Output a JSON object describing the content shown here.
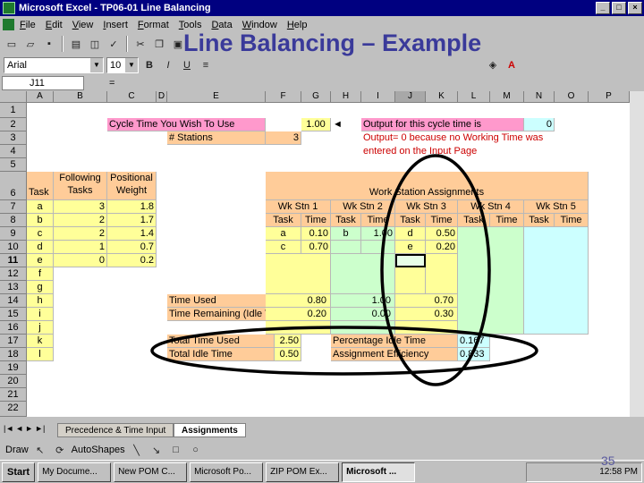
{
  "window": {
    "title": "Microsoft Excel - TP06-01 Line Balancing",
    "controls": [
      "_",
      "□",
      "×"
    ]
  },
  "menu": [
    "File",
    "Edit",
    "View",
    "Insert",
    "Format",
    "Tools",
    "Data",
    "Window",
    "Help"
  ],
  "slide_title": "Line Balancing – Example",
  "format_toolbar": {
    "font": "Arial",
    "size": "10"
  },
  "formula_bar": {
    "name_box": "J11",
    "equals": "="
  },
  "column_headers": [
    "A",
    "B",
    "C",
    "D",
    "E",
    "F",
    "G",
    "H",
    "I",
    "J",
    "K",
    "L",
    "M",
    "N",
    "O",
    "P"
  ],
  "row_numbers": [
    "1",
    "2",
    "3",
    "4",
    "5",
    "6",
    "7",
    "8",
    "9",
    "10",
    "11",
    "12",
    "13",
    "14",
    "15",
    "16",
    "17",
    "18",
    "19",
    "20",
    "21",
    "22"
  ],
  "sheet": {
    "cycle_time_label": "Cycle Time You Wish To Use",
    "cycle_time_value": "1.00",
    "stations_label": "# Stations",
    "stations_value": "3",
    "output_label": "Output for this cycle time is",
    "output_value": "0",
    "output_note_1": "Output= 0 because no Working Time was",
    "output_note_2": "entered on the Input Page",
    "headers": {
      "task": "Task",
      "following_1": "Following",
      "following_2": "Tasks",
      "positional_1": "Positional",
      "positional_2": "Weight",
      "assignments": "Work Station Assignments"
    },
    "stations": [
      "Wk Stn 1",
      "Wk Stn 2",
      "Wk Stn 3",
      "Wk Stn 4",
      "Wk Stn 5"
    ],
    "sub_task": "Task",
    "sub_time": "Time",
    "tasks": [
      {
        "task": "a",
        "following": "3",
        "weight": "1.8"
      },
      {
        "task": "b",
        "following": "2",
        "weight": "1.7"
      },
      {
        "task": "c",
        "following": "2",
        "weight": "1.4"
      },
      {
        "task": "d",
        "following": "1",
        "weight": "0.7"
      },
      {
        "task": "e",
        "following": "0",
        "weight": "0.2"
      },
      {
        "task": "f",
        "following": "",
        "weight": ""
      },
      {
        "task": "g",
        "following": "",
        "weight": ""
      },
      {
        "task": "h",
        "following": "",
        "weight": ""
      },
      {
        "task": "i",
        "following": "",
        "weight": ""
      },
      {
        "task": "j",
        "following": "",
        "weight": ""
      },
      {
        "task": "k",
        "following": "",
        "weight": ""
      },
      {
        "task": "l",
        "following": "",
        "weight": ""
      }
    ],
    "assign_rows": [
      {
        "s1_task": "a",
        "s1_time": "0.10",
        "s2_task": "b",
        "s2_time": "1.00",
        "s3_task": "d",
        "s3_time": "0.50"
      },
      {
        "s1_task": "c",
        "s1_time": "0.70",
        "s2_task": "",
        "s2_time": "",
        "s3_task": "e",
        "s3_time": "0.20"
      }
    ],
    "time_used_label": "Time Used",
    "time_remaining_label": "Time Remaining (Idle Time)",
    "time_used": [
      "0.80",
      "1.00",
      "0.70"
    ],
    "time_remaining": [
      "0.20",
      "0.00",
      "0.30"
    ],
    "total_time_used_label": "Total Time Used",
    "total_time_used": "2.50",
    "total_idle_label": "Total Idle Time",
    "total_idle": "0.50",
    "pct_idle_label": "Percentage Idle Time",
    "pct_idle": "0.167",
    "efficiency_label": "Assignment Efficiency",
    "efficiency": "0.833"
  },
  "sheet_tabs": [
    "Precedence & Time Input",
    "Assignments"
  ],
  "draw_toolbar": {
    "draw": "Draw",
    "autoshapes": "AutoShapes"
  },
  "taskbar": {
    "start": "Start",
    "buttons": [
      "My Docume...",
      "New POM C...",
      "Microsoft Po...",
      "ZIP POM Ex...",
      "Microsoft ..."
    ],
    "clock": "12:58 PM"
  },
  "page_number": "35",
  "colors": {
    "pink": "#ff99cc",
    "tan": "#ffcc99",
    "yellow": "#ffff99",
    "cyan": "#ccffff",
    "green": "#ccffcc",
    "title_blue": "#3a3a9a"
  }
}
